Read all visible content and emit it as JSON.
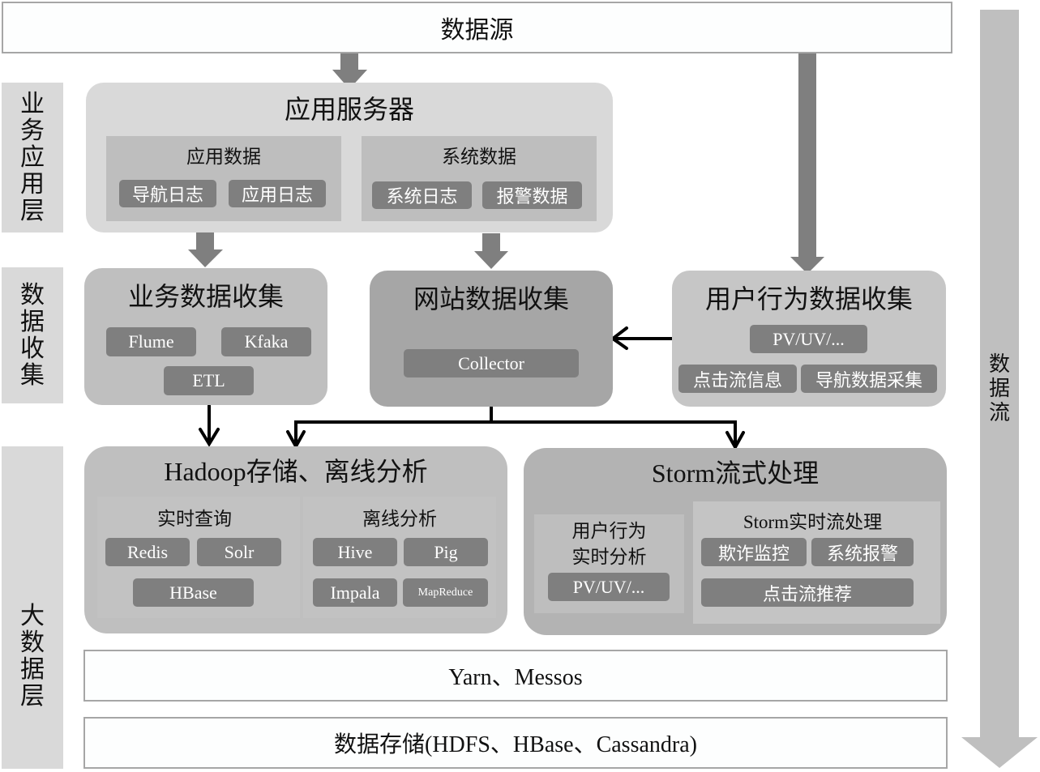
{
  "source": {
    "label": "数据源"
  },
  "dataflow": {
    "label": "数据流"
  },
  "layers": {
    "business_app": "业务应用层",
    "data_collection": "数据收集",
    "big_data": "大数据层"
  },
  "app_server": {
    "title": "应用服务器",
    "app_data": {
      "title": "应用数据",
      "items": [
        "导航日志",
        "应用日志"
      ]
    },
    "sys_data": {
      "title": "系统数据",
      "items": [
        "系统日志",
        "报警数据"
      ]
    }
  },
  "business_collect": {
    "title": "业务数据收集",
    "items": [
      "Flume",
      "Kfaka",
      "ETL"
    ]
  },
  "web_collect": {
    "title": "网站数据收集",
    "items": [
      "Collector"
    ]
  },
  "user_collect": {
    "title": "用户行为数据收集",
    "items": [
      "PV/UV/...",
      "点击流信息",
      "导航数据采集"
    ]
  },
  "hadoop": {
    "title": "Hadoop存储、离线分析",
    "realtime_query": {
      "title": "实时查询",
      "items": [
        "Redis",
        "Solr",
        "HBase"
      ]
    },
    "offline": {
      "title": "离线分析",
      "items": [
        "Hive",
        "Pig",
        "Impala",
        "MapReduce"
      ]
    }
  },
  "storm": {
    "title": "Storm流式处理",
    "user_realtime": {
      "title_line1": "用户行为",
      "title_line2": "实时分析",
      "items": [
        "PV/UV/..."
      ]
    },
    "storm_stream": {
      "title": "Storm实时流处理",
      "items": [
        "欺诈监控",
        "系统报警",
        "点击流推荐"
      ]
    }
  },
  "yarn": {
    "label": "Yarn、Messos"
  },
  "storage": {
    "label": "数据存储(HDFS、HBase、Cassandra)"
  },
  "colors": {
    "arrow_gray": "#7f7f7f",
    "flow_arrow": "#bfbfbf",
    "connector": "#000000"
  }
}
